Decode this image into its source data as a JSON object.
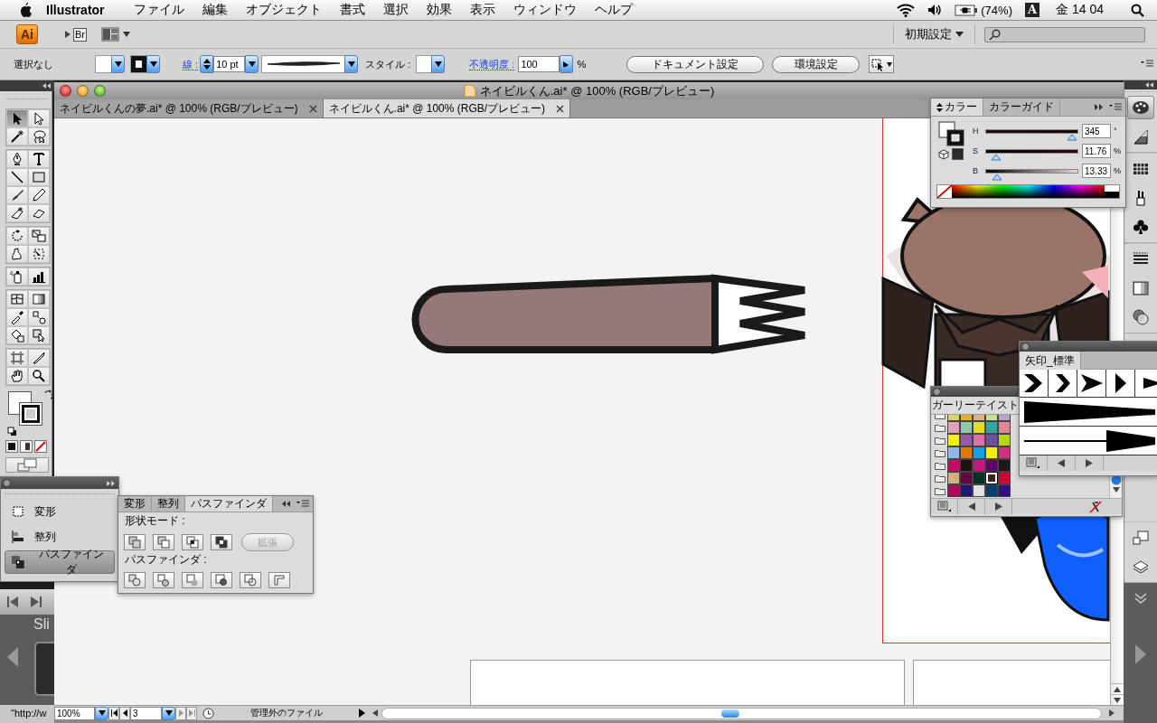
{
  "menu_bar": {
    "app_name": "Illustrator",
    "menus": [
      "ファイル",
      "編集",
      "オブジェクト",
      "書式",
      "選択",
      "効果",
      "表示",
      "ウィンドウ",
      "ヘルプ"
    ],
    "battery": "(74%)",
    "input_source": "A",
    "clock": "金 14 04"
  },
  "app_bar": {
    "app_logo": "Ai",
    "bridge_button": "Br",
    "workspace": "初期設定"
  },
  "control_bar": {
    "selection": "選択なし",
    "stroke_label": "線 :",
    "stroke_weight": "10 pt",
    "style_label": "スタイル :",
    "opacity_label": "不透明度 :",
    "opacity": "100",
    "opacity_unit": "%",
    "buttons": [
      "ドキュメント設定",
      "環境設定"
    ]
  },
  "tools": [
    {
      "kind": "select",
      "selected": true
    },
    {
      "kind": "direct",
      "selected": false
    },
    {
      "kind": "wand",
      "selected": false
    },
    {
      "kind": "lasso",
      "selected": false
    },
    {
      "kind": "pen",
      "selected": false
    },
    {
      "kind": "type",
      "selected": false
    },
    {
      "kind": "line",
      "selected": false
    },
    {
      "kind": "rect",
      "selected": false
    },
    {
      "kind": "brush",
      "selected": false
    },
    {
      "kind": "pencil",
      "selected": false
    },
    {
      "kind": "blob",
      "selected": false
    },
    {
      "kind": "eraser",
      "selected": false
    },
    {
      "kind": "rotate",
      "selected": false
    },
    {
      "kind": "scale",
      "selected": false
    },
    {
      "kind": "warp",
      "selected": false
    },
    {
      "kind": "transform",
      "selected": false
    },
    {
      "kind": "spray",
      "selected": false
    },
    {
      "kind": "graph",
      "selected": false
    },
    {
      "kind": "mesh",
      "selected": false
    },
    {
      "kind": "gradient",
      "selected": false
    },
    {
      "kind": "eyedropper",
      "selected": false
    },
    {
      "kind": "blend",
      "selected": false
    },
    {
      "kind": "bucket",
      "selected": false
    },
    {
      "kind": "liveselect",
      "selected": false
    },
    {
      "kind": "crop",
      "selected": false
    },
    {
      "kind": "knife",
      "selected": false
    },
    {
      "kind": "hand",
      "selected": false
    },
    {
      "kind": "zoom",
      "selected": false
    }
  ],
  "document": {
    "title": "ネイビルくん.ai* @ 100% (RGB/プレビュー)",
    "tabs": [
      {
        "label": "ネイビルくんの夢.ai* @ 100% (RGB/プレビュー)",
        "selected": false
      },
      {
        "label": "ネイビルくん.ai* @ 100% (RGB/プレビュー)",
        "selected": true
      }
    ],
    "status_bar": {
      "zoom": "100%",
      "artboard": "3",
      "info": "管理外のファイル"
    }
  },
  "color_panel": {
    "tabs": [
      {
        "label": "カラー",
        "selected": true
      },
      {
        "label": "カラーガイド",
        "selected": false
      }
    ],
    "channels": [
      {
        "name": "H",
        "value": "345",
        "unit": "°",
        "level": 0.94
      },
      {
        "name": "S",
        "value": "11.76",
        "unit": "%",
        "level": 0.11
      },
      {
        "name": "B",
        "value": "13.33",
        "unit": "%",
        "level": 0.12
      }
    ]
  },
  "swatches_panel": {
    "title": "ガーリーテイスト",
    "rows": [
      [
        {
          "color": "#d8d860",
          "selected": false
        },
        {
          "color": "#e8b020",
          "selected": false
        },
        {
          "color": "#e0b080",
          "selected": false
        },
        {
          "color": "#c8e090",
          "selected": false
        },
        {
          "color": "#c0a0c8",
          "selected": false
        }
      ],
      [
        {
          "color": "#e0a0b8",
          "selected": false
        },
        {
          "color": "#90c8a8",
          "selected": false
        },
        {
          "color": "#e0e020",
          "selected": false
        },
        {
          "color": "#30a8a0",
          "selected": false
        },
        {
          "color": "#e08890",
          "selected": false
        }
      ],
      [
        {
          "color": "#f0f000",
          "selected": false
        },
        {
          "color": "#9858a8",
          "selected": false
        },
        {
          "color": "#e070a8",
          "selected": false
        },
        {
          "color": "#7050a0",
          "selected": false
        },
        {
          "color": "#b8d800",
          "selected": false
        }
      ],
      [
        {
          "color": "#90b8e8",
          "selected": false
        },
        {
          "color": "#e07808",
          "selected": false
        },
        {
          "color": "#10a0e8",
          "selected": false
        },
        {
          "color": "#f8f000",
          "selected": false
        },
        {
          "color": "#d03080",
          "selected": false
        }
      ],
      [
        {
          "color": "#c80868",
          "selected": false
        },
        {
          "color": "#201010",
          "selected": false
        },
        {
          "color": "#c81880",
          "selected": false
        },
        {
          "color": "#600070",
          "selected": false
        },
        {
          "color": "#201818",
          "selected": false
        }
      ],
      [
        {
          "color": "#d0b080",
          "selected": false
        },
        {
          "color": "#600840",
          "selected": false
        },
        {
          "color": "#003028",
          "selected": false
        },
        {
          "color": "#402020",
          "selected": true
        },
        {
          "color": "#d00030",
          "selected": false
        }
      ],
      [
        {
          "color": "#b00858",
          "selected": false
        },
        {
          "color": "#201870",
          "selected": false
        },
        {
          "color": "#e0e0e0",
          "selected": false
        },
        {
          "color": "#004070",
          "selected": false
        },
        {
          "color": "#301080",
          "selected": false
        }
      ]
    ]
  },
  "arrows_panel": {
    "title": "矢印_標準"
  },
  "panels_menu": {
    "items": [
      {
        "label": "変形",
        "selected": false
      },
      {
        "label": "整列",
        "selected": false
      },
      {
        "label": "パスファインダ",
        "selected": true
      }
    ]
  },
  "pathfinder_panel": {
    "tabs": [
      {
        "label": "変形",
        "selected": false
      },
      {
        "label": "整列",
        "selected": false
      },
      {
        "label": "パスファインダ",
        "selected": true
      }
    ],
    "shape_modes_label": "形状モード :",
    "expand_button": {
      "label": "拡張",
      "disabled": true
    },
    "pathfinders_label": "パスファインダ :"
  },
  "background_window": {
    "title": "Sli",
    "status": "\"http://w"
  }
}
